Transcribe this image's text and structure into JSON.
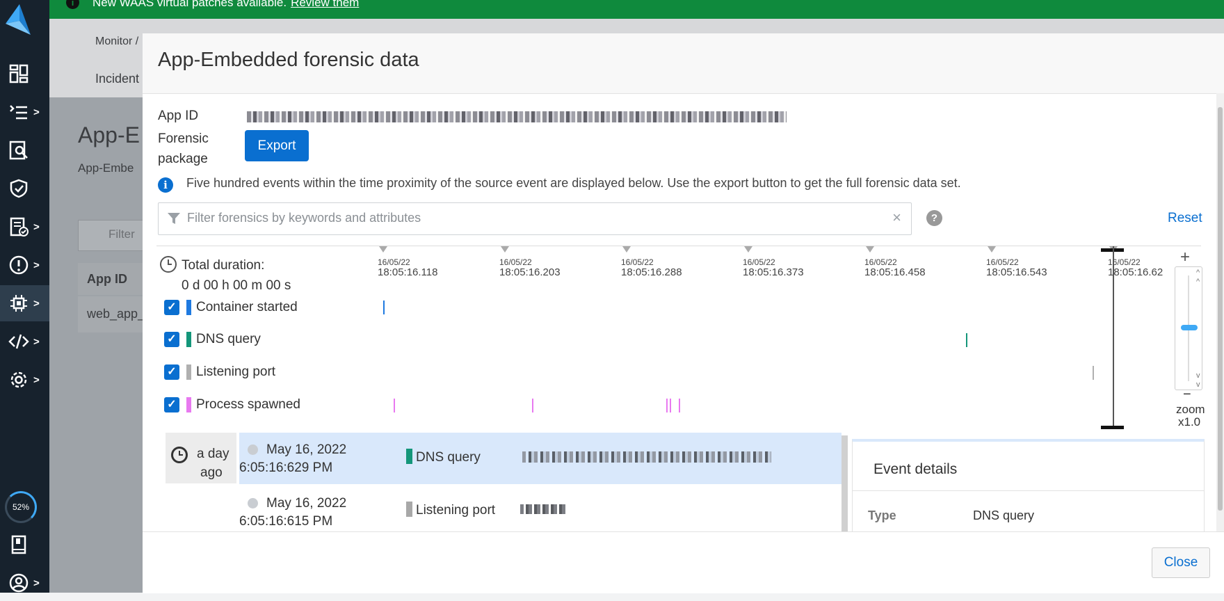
{
  "banner": {
    "text": "New WAAS virtual patches available.",
    "link": "Review them"
  },
  "sidebar": {
    "progress": "52%",
    "progress_value": 0.52
  },
  "background": {
    "breadcrumb": "Monitor /",
    "tab": "Incident",
    "page_title": "App-E",
    "page_subtitle": "App-Embe",
    "filter": "Filter",
    "col_header": "App ID",
    "row_value": "web_app_"
  },
  "modal": {
    "title": "App-Embedded forensic data",
    "app_id_label": "App ID",
    "forensic_label_1": "Forensic",
    "forensic_label_2": "package",
    "export_label": "Export",
    "info_text": "Five hundred events within the time proximity of the source event are displayed below. Use the export button to get the full forensic data set.",
    "filter_placeholder": "Filter forensics by keywords and attributes",
    "filter_clear": "×",
    "help": "?",
    "reset": "Reset",
    "close": "Close"
  },
  "timeline": {
    "total_label": "Total duration:",
    "total_value": "0 d 00 h 00 m 00 s",
    "ticks": [
      {
        "date": "16/05/22",
        "time": "18:05:16.118"
      },
      {
        "date": "16/05/22",
        "time": "18:05:16.203"
      },
      {
        "date": "16/05/22",
        "time": "18:05:16.288"
      },
      {
        "date": "16/05/22",
        "time": "18:05:16.373"
      },
      {
        "date": "16/05/22",
        "time": "18:05:16.458"
      },
      {
        "date": "16/05/22",
        "time": "18:05:16.543"
      },
      {
        "date": "16/05/22",
        "time": "18:05:16.62"
      }
    ],
    "rows": [
      {
        "label": "Container started",
        "color": "#1f7ae0"
      },
      {
        "label": "DNS query",
        "color": "#14967a"
      },
      {
        "label": "Listening port",
        "color": "#b0b0b0"
      },
      {
        "label": "Process spawned",
        "color": "#e879f0"
      }
    ],
    "zoom_plus": "+",
    "zoom_minus": "−",
    "zoom_label": "zoom",
    "zoom_value": "x1.0"
  },
  "events": {
    "ago_1": "a day",
    "ago_2": "ago",
    "items": [
      {
        "date": "May 16, 2022",
        "time": "6:05:16:629 PM",
        "type": "DNS query",
        "color": "#14967a"
      },
      {
        "date": "May 16, 2022",
        "time": "6:05:16:615 PM",
        "type": "Listening port",
        "color": "#a8a8a8"
      }
    ]
  },
  "details": {
    "title": "Event details",
    "type_label": "Type",
    "type_value": "DNS query"
  }
}
